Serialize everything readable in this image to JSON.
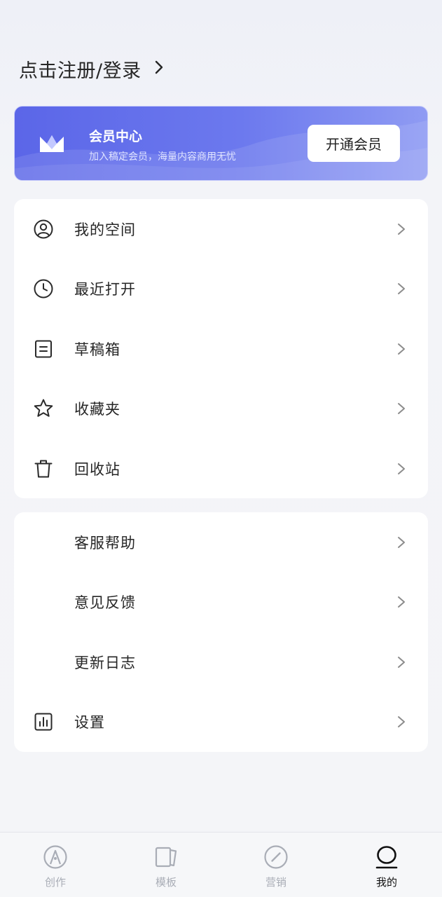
{
  "header": {
    "login_label": "点击注册/登录"
  },
  "vip": {
    "title": "会员中心",
    "subtitle": "加入稿定会员，海量内容商用无忧",
    "button_label": "开通会员"
  },
  "menu_primary": [
    {
      "label": "我的空间",
      "icon": "user-circle-icon"
    },
    {
      "label": "最近打开",
      "icon": "clock-icon"
    },
    {
      "label": "草稿箱",
      "icon": "draft-box-icon"
    },
    {
      "label": "收藏夹",
      "icon": "star-icon"
    },
    {
      "label": "回收站",
      "icon": "trash-icon"
    }
  ],
  "menu_secondary": [
    {
      "label": "客服帮助"
    },
    {
      "label": "意见反馈"
    },
    {
      "label": "更新日志"
    },
    {
      "label": "设置",
      "icon": "bar-chart-icon"
    }
  ],
  "tabbar": [
    {
      "label": "创作",
      "icon": "create-icon",
      "active": false
    },
    {
      "label": "模板",
      "icon": "template-icon",
      "active": false
    },
    {
      "label": "营销",
      "icon": "compass-icon",
      "active": false
    },
    {
      "label": "我的",
      "icon": "profile-icon",
      "active": true
    }
  ],
  "colors": {
    "accent": "#5b66e8",
    "tab_active": "#111111",
    "tab_inactive": "#a9adb6"
  }
}
